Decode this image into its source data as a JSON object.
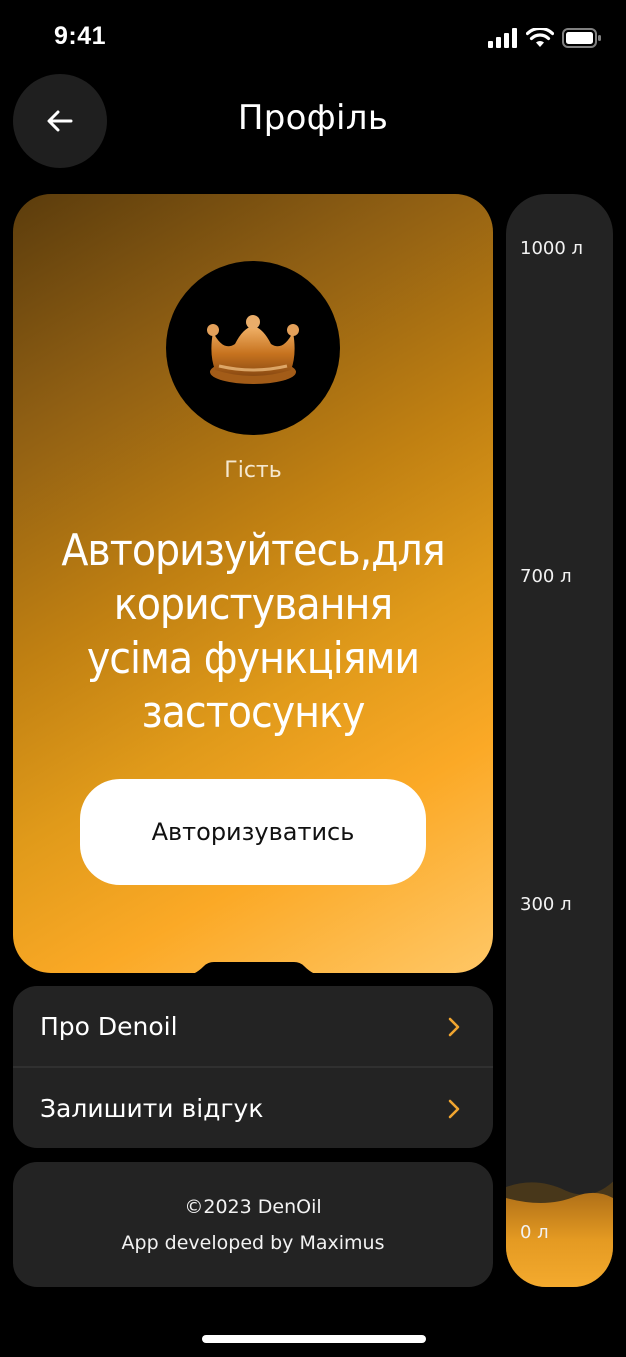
{
  "status_bar": {
    "time": "9:41"
  },
  "header": {
    "title": "Профіль",
    "back_icon": "arrow-left-icon"
  },
  "profile_card": {
    "avatar_icon": "crown-icon",
    "user_label": "Гість",
    "prompt_lines": [
      "Авторизуйтесь,для",
      "користування",
      "усіма функціями",
      "застосунку"
    ],
    "auth_button_label": "Авторизуватись",
    "gradient_colors": [
      "#5b3c0c",
      "#c08012",
      "#fba926",
      "#ffc766"
    ]
  },
  "menu": {
    "items": [
      {
        "label": "Про Denoil",
        "icon": "chevron-right-icon"
      },
      {
        "label": "Залишити відгук",
        "icon": "chevron-right-icon"
      }
    ],
    "chevron_color": "#f0a530"
  },
  "footer": {
    "copyright": "©2023 DenOil",
    "developer": "App developed by Maximus"
  },
  "fuel_gauge": {
    "labels": [
      "1000 л",
      "700 л",
      "300 л",
      "0 л"
    ],
    "fill_fraction": 0.1,
    "fill_color": "#e49a22"
  }
}
